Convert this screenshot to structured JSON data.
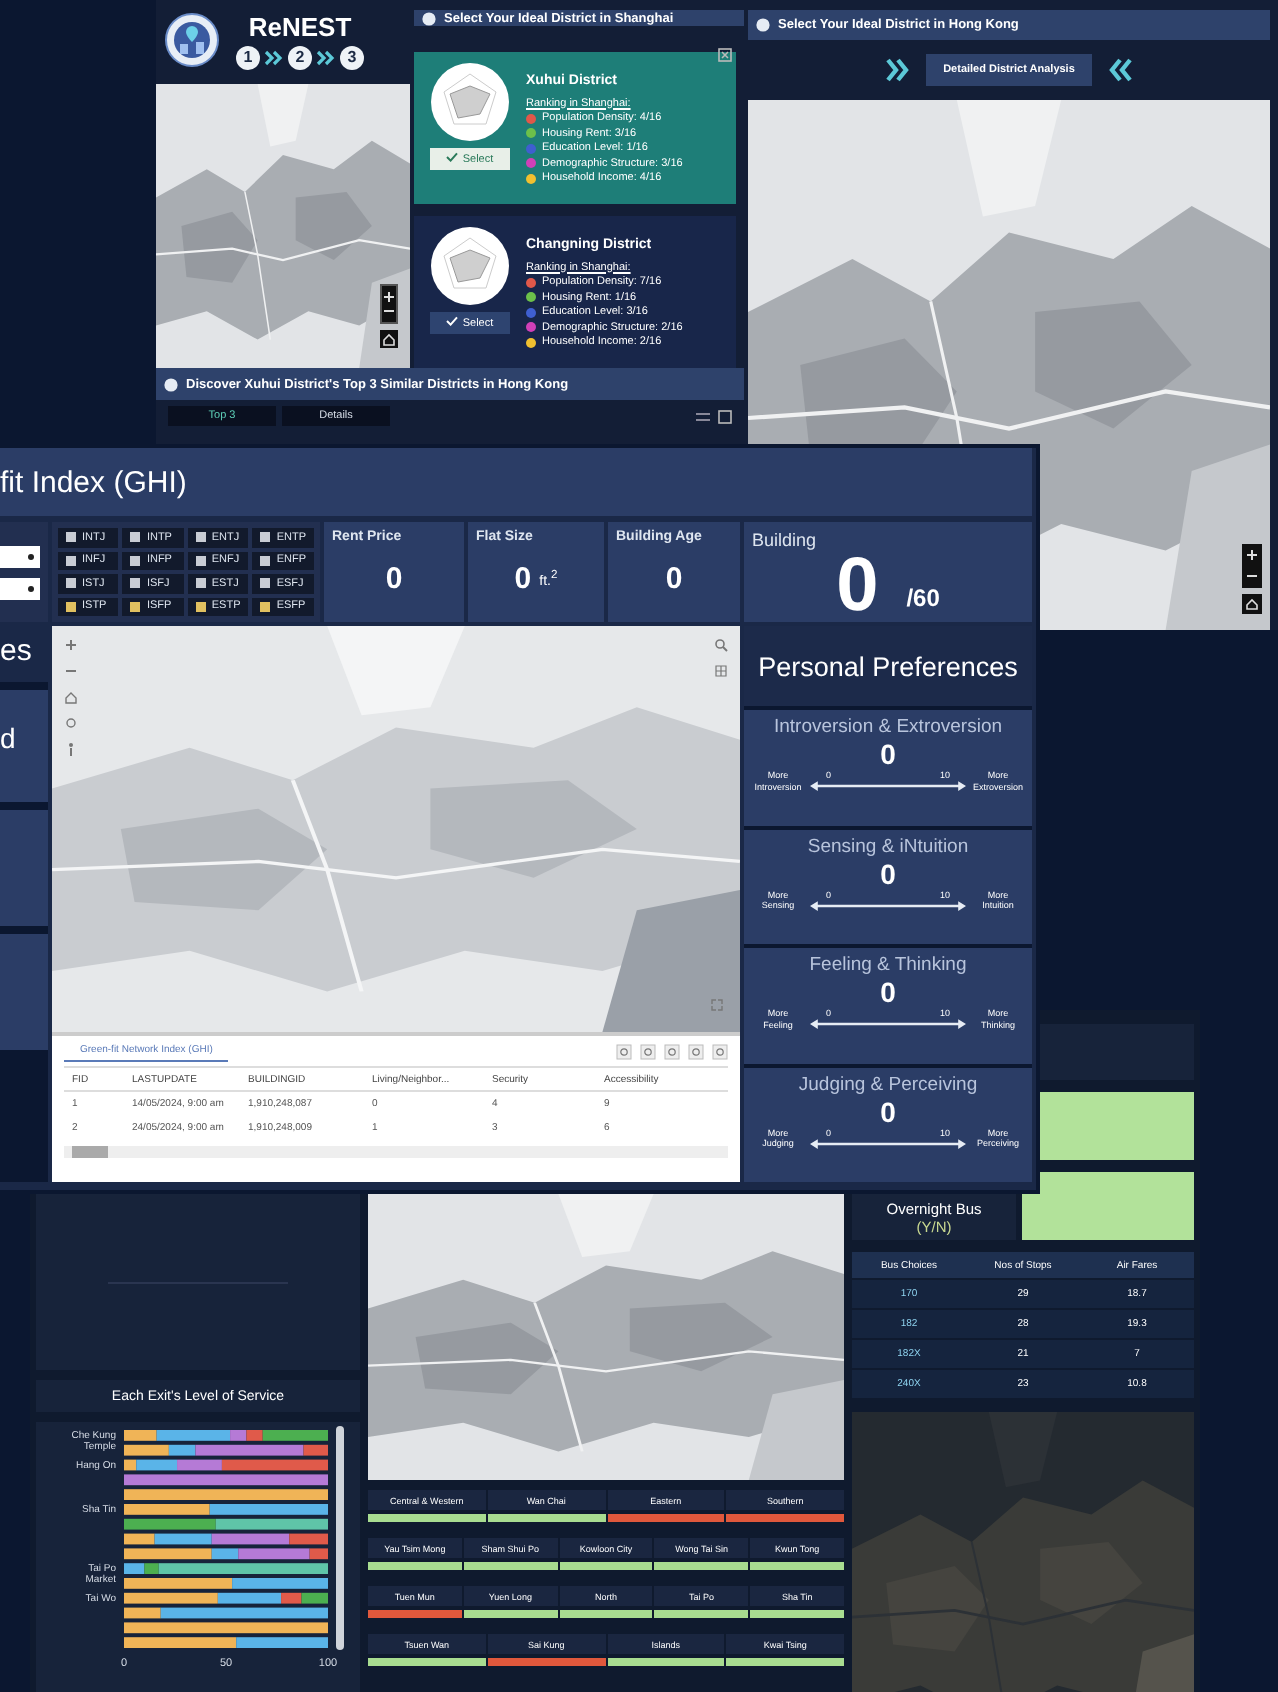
{
  "shanghai_window": {
    "app_name": "ReNEST",
    "steps": [
      "1",
      "2",
      "3"
    ],
    "title": "Select Your Ideal District in Shanghai",
    "districts": [
      {
        "name": "Xuhui District",
        "ranking_label": "Ranking in Shanghai:",
        "selected": true,
        "button": "Select",
        "rankings": [
          {
            "text": "Population Density: 4/16",
            "color": "#e0584a"
          },
          {
            "text": "Housing Rent: 3/16",
            "color": "#6cc04a"
          },
          {
            "text": "Education Level: 1/16",
            "color": "#3f5fd0"
          },
          {
            "text": "Demographic Structure: 3/16",
            "color": "#d040b8"
          },
          {
            "text": "Household Income: 4/16",
            "color": "#f0c030"
          }
        ]
      },
      {
        "name": "Changning District",
        "ranking_label": "Ranking in Shanghai:",
        "selected": false,
        "button": "Select",
        "rankings": [
          {
            "text": "Population Density: 7/16",
            "color": "#e0584a"
          },
          {
            "text": "Housing Rent: 1/16",
            "color": "#6cc04a"
          },
          {
            "text": "Education Level: 3/16",
            "color": "#3f5fd0"
          },
          {
            "text": "Demographic Structure: 2/16",
            "color": "#d040b8"
          },
          {
            "text": "Household Income: 2/16",
            "color": "#f0c030"
          }
        ]
      }
    ],
    "footer_title": "Discover Xuhui District's Top 3 Similar Districts in Hong Kong",
    "tabs": [
      {
        "label": "Top 3",
        "selected": true
      },
      {
        "label": "Details",
        "selected": false
      }
    ]
  },
  "hongkong_window": {
    "title": "Select Your Ideal District in Hong Kong",
    "button": "Detailed District Analysis"
  },
  "ghi": {
    "title": "fit Index (GHI)",
    "mbti": [
      {
        "label": "INTJ",
        "checked": false
      },
      {
        "label": "INTP",
        "checked": false
      },
      {
        "label": "ENTJ",
        "checked": false
      },
      {
        "label": "ENTP",
        "checked": false
      },
      {
        "label": "INFJ",
        "checked": false
      },
      {
        "label": "INFP",
        "checked": false
      },
      {
        "label": "ENFJ",
        "checked": false
      },
      {
        "label": "ENFP",
        "checked": false
      },
      {
        "label": "ISTJ",
        "checked": false
      },
      {
        "label": "ISFJ",
        "checked": false
      },
      {
        "label": "ESTJ",
        "checked": false
      },
      {
        "label": "ESFJ",
        "checked": false
      },
      {
        "label": "ISTP",
        "checked": true
      },
      {
        "label": "ISFP",
        "checked": true
      },
      {
        "label": "ESTP",
        "checked": true
      },
      {
        "label": "ESFP",
        "checked": true
      }
    ],
    "stats": [
      {
        "label": "Rent Price",
        "value": "0"
      },
      {
        "label": "Flat Size",
        "value": "0",
        "unit": "ft.$^{2}$"
      },
      {
        "label": "Building Age",
        "value": "0"
      }
    ],
    "building": {
      "label": "Building",
      "value": "0",
      "total": "/60"
    },
    "side_texts": [
      "es",
      "d"
    ],
    "table": {
      "tab": "Green-fit Network Index (GHI)",
      "columns": [
        "FID",
        "LASTUPDATE",
        "BUILDINGID",
        "Living/Neighbor...",
        "Security",
        "Accessibility"
      ],
      "rows": [
        [
          "1",
          "14/05/2024, 9:00 am",
          "1,910,248,087",
          "0",
          "4",
          "9"
        ],
        [
          "2",
          "24/05/2024, 9:00 am",
          "1,910,248,009",
          "1",
          "3",
          "6"
        ]
      ]
    },
    "preferences": {
      "title": "Personal Preferences",
      "scales": [
        {
          "title": "Introversion & Extroversion",
          "value": "0",
          "min": "0",
          "max": "10",
          "left": "More Introversion",
          "right": "More Extroversion"
        },
        {
          "title": "Sensing & iNtuition",
          "value": "0",
          "min": "0",
          "max": "10",
          "left": "More Sensing",
          "right": "More Intuition"
        },
        {
          "title": "Feeling & Thinking",
          "value": "0",
          "min": "0",
          "max": "10",
          "left": "More Feeling",
          "right": "More Thinking"
        },
        {
          "title": "Judging & Perceiving",
          "value": "0",
          "min": "0",
          "max": "10",
          "left": "More Judging",
          "right": "More Perceiving"
        }
      ]
    }
  },
  "transit": {
    "exit_chart": {
      "title": "Each Exit's Level of Service",
      "chart_data": {
        "type": "bar",
        "orientation": "horizontal",
        "stacked": true,
        "categories": [
          "Che Kung Temple",
          null,
          "Hang On",
          null,
          null,
          "Sha Tin",
          null,
          null,
          null,
          "Tai Po Market",
          null,
          "Tai Wo",
          null,
          null,
          null
        ],
        "xticks": [
          0,
          50,
          100
        ],
        "xlim": [
          0,
          100
        ],
        "series": [
          {
            "color": "#f0b457",
            "values": [
              16,
              22,
              6,
              0,
              100,
              42,
              0,
              15,
              43,
              0,
              53,
              46,
              18,
              100,
              55
            ]
          },
          {
            "color": "#5ab4e8",
            "values": [
              36,
              13,
              20,
              0,
              0,
              58,
              0,
              28,
              13,
              10,
              47,
              31,
              82,
              0,
              45
            ]
          },
          {
            "color": "#b57ad6",
            "values": [
              8,
              53,
              22,
              100,
              0,
              0,
              0,
              38,
              35,
              0,
              0,
              0,
              0,
              0,
              0
            ]
          },
          {
            "color": "#e05a4a",
            "values": [
              8,
              12,
              52,
              0,
              0,
              0,
              0,
              19,
              9,
              0,
              0,
              10,
              0,
              0,
              0
            ]
          },
          {
            "color": "#4caf50",
            "values": [
              32,
              0,
              0,
              0,
              0,
              0,
              45,
              0,
              0,
              7,
              0,
              13,
              0,
              0,
              0
            ]
          },
          {
            "color": "#5fc4a8",
            "values": [
              0,
              0,
              0,
              0,
              0,
              0,
              55,
              0,
              0,
              83,
              0,
              0,
              0,
              0,
              0
            ]
          }
        ]
      }
    },
    "districts": [
      [
        {
          "name": "Central & Western",
          "color": "#a8dc90"
        },
        {
          "name": "Wan Chai",
          "color": "#a8dc90"
        },
        {
          "name": "Eastern",
          "color": "#e0583c"
        },
        {
          "name": "Southern",
          "color": "#e0583c"
        }
      ],
      [
        {
          "name": "Yau Tsim Mong",
          "color": "#a8dc90"
        },
        {
          "name": "Sham Shui Po",
          "color": "#a8dc90"
        },
        {
          "name": "Kowloon City",
          "color": "#a8dc90"
        },
        {
          "name": "Wong Tai Sin",
          "color": "#a8dc90"
        },
        {
          "name": "Kwun Tong",
          "color": "#a8dc90"
        }
      ],
      [
        {
          "name": "Tuen Mun",
          "color": "#e0583c"
        },
        {
          "name": "Yuen Long",
          "color": "#a8dc90"
        },
        {
          "name": "North",
          "color": "#a8dc90"
        },
        {
          "name": "Tai Po",
          "color": "#a8dc90"
        },
        {
          "name": "Sha Tin",
          "color": "#a8dc90"
        }
      ],
      [
        {
          "name": "Tsuen Wan",
          "color": "#a8dc90"
        },
        {
          "name": "Sai Kung",
          "color": "#e0583c"
        },
        {
          "name": "Islands",
          "color": "#a8dc90"
        },
        {
          "name": "Kwai Tsing",
          "color": "#a8dc90"
        }
      ]
    ],
    "overnight_label": "Overnight Bus",
    "overnight_yn": "(Y/N)",
    "bus_table": {
      "columns": [
        "Bus Choices",
        "Nos of Stops",
        "Air Fares"
      ],
      "rows": [
        [
          "170",
          "29",
          "18.7"
        ],
        [
          "182",
          "28",
          "19.3"
        ],
        [
          "182X",
          "21",
          "7"
        ],
        [
          "240X",
          "23",
          "10.8"
        ]
      ]
    }
  }
}
